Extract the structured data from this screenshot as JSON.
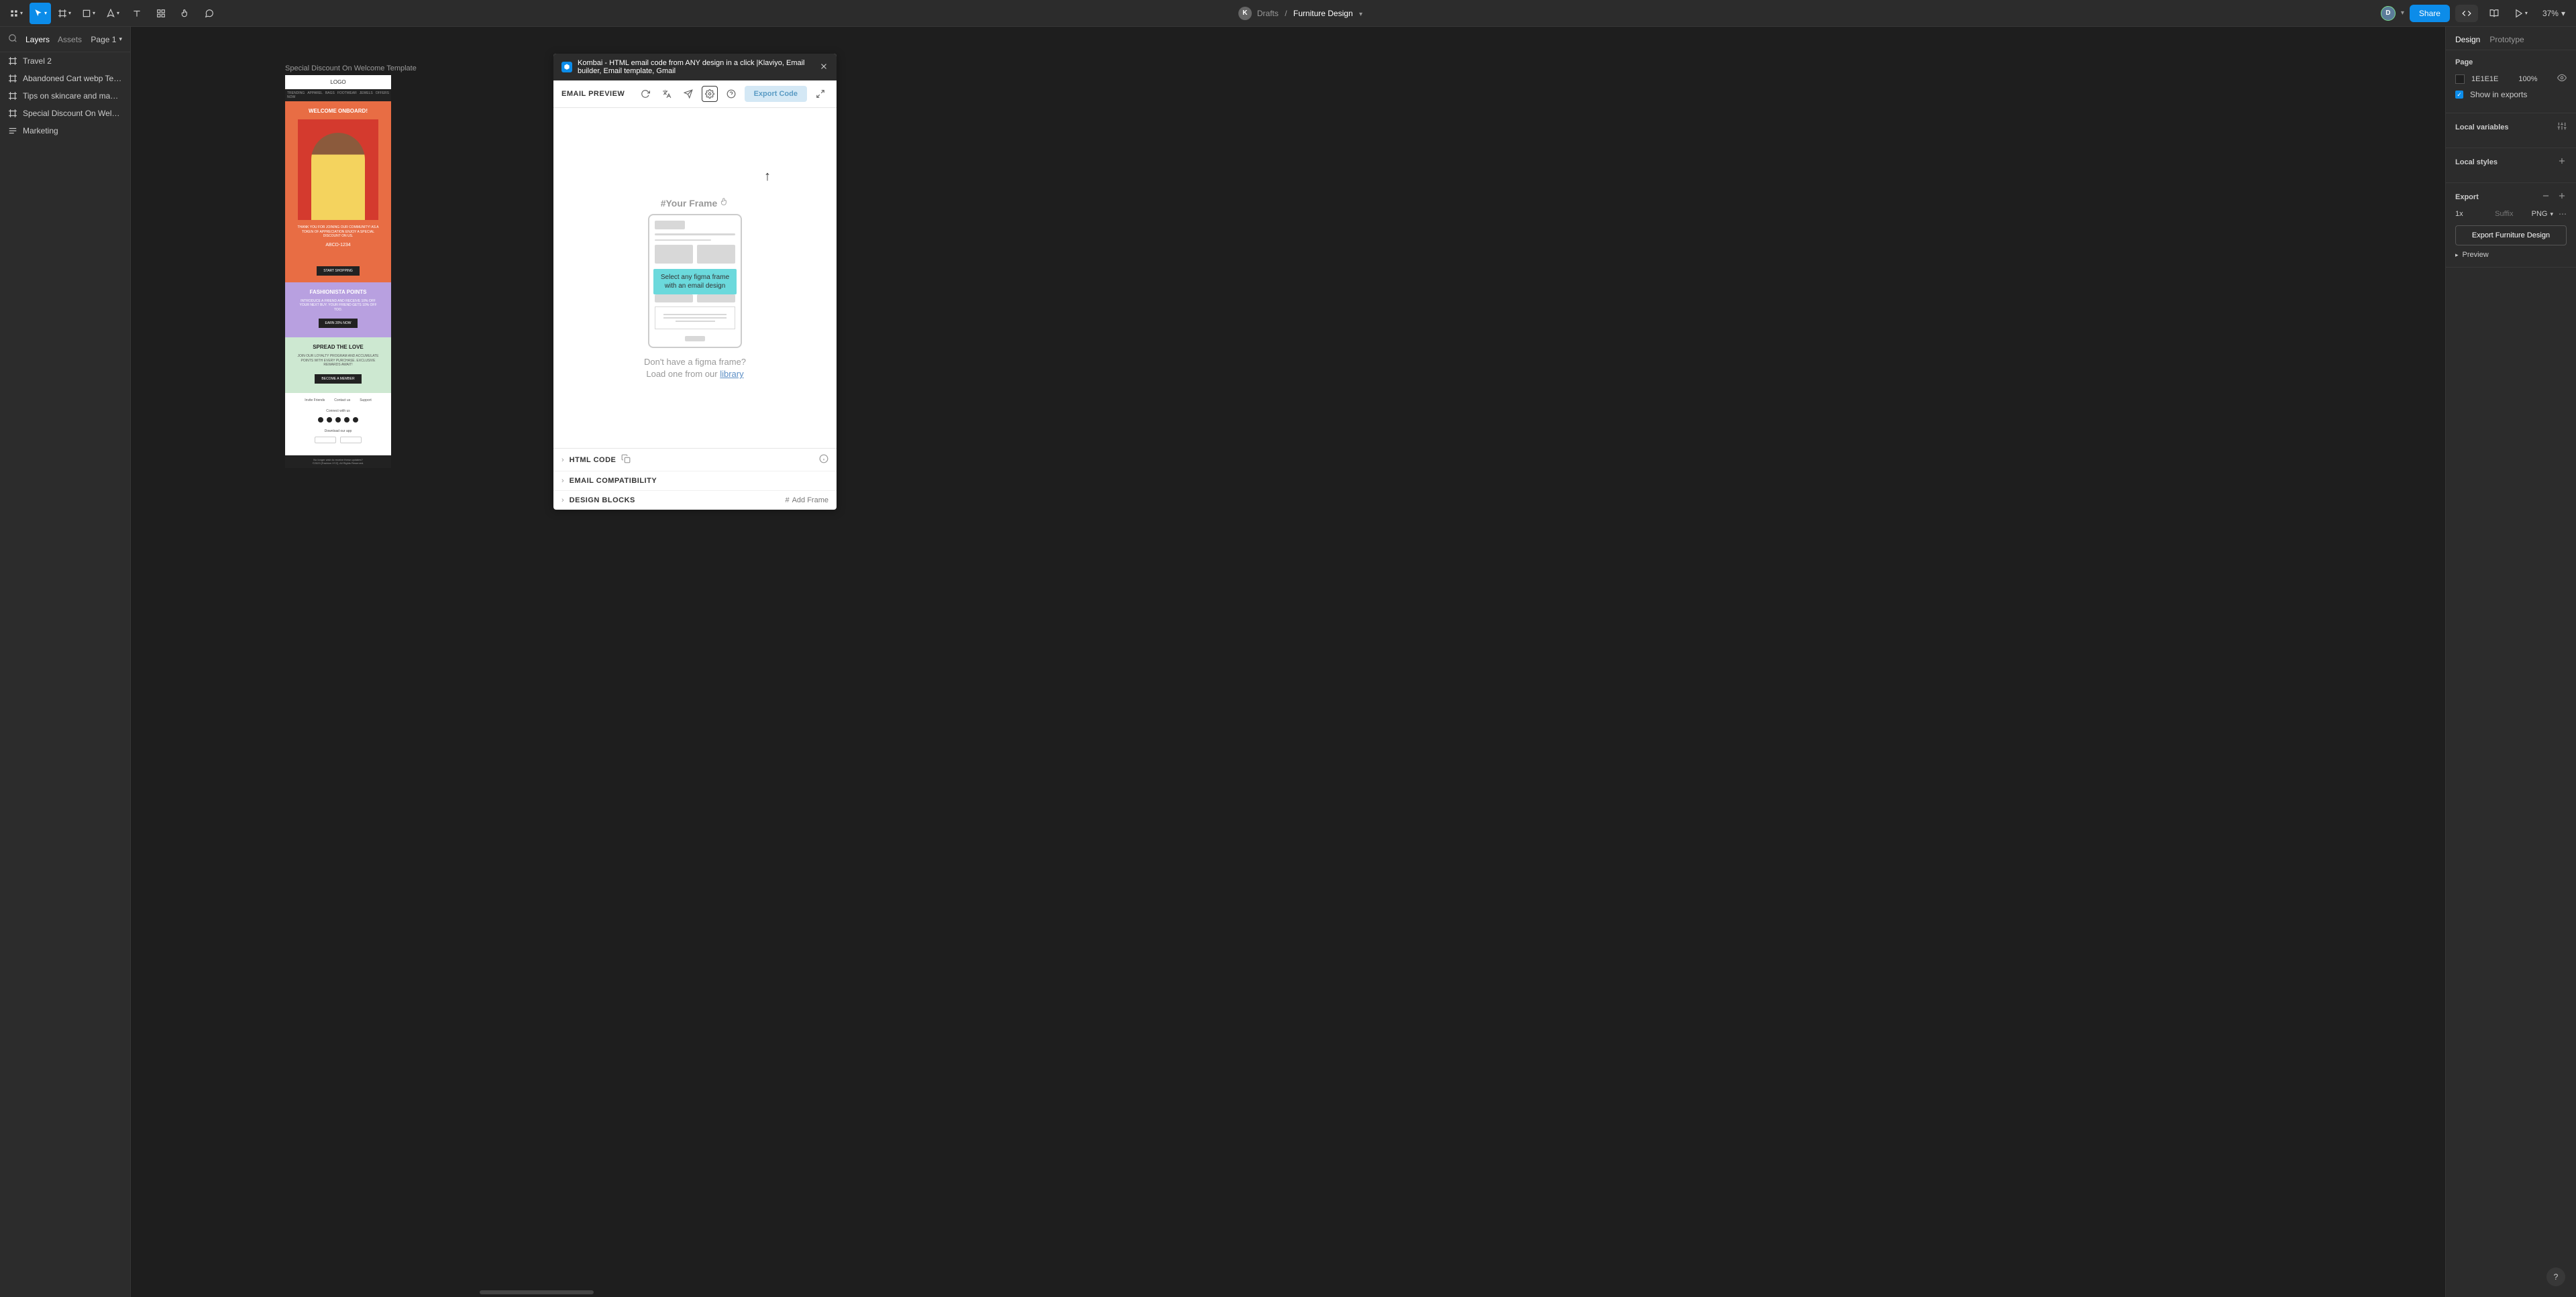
{
  "toolbar": {
    "avatar_k": "K",
    "avatar_d": "D",
    "breadcrumb_parent": "Drafts",
    "breadcrumb_current": "Furniture Design",
    "share_label": "Share",
    "zoom": "37%"
  },
  "left_panel": {
    "tab_layers": "Layers",
    "tab_assets": "Assets",
    "page_selector": "Page 1",
    "layers": [
      {
        "name": "Travel 2",
        "type": "frame"
      },
      {
        "name": "Abandoned Cart webp Template 5",
        "type": "frame"
      },
      {
        "name": "Tips on skincare and makeup 5",
        "type": "frame"
      },
      {
        "name": "Special Discount On Welcome Te...",
        "type": "frame"
      },
      {
        "name": "Marketing",
        "type": "text"
      }
    ]
  },
  "canvas": {
    "frame_label": "Special Discount On Welcome Template",
    "email": {
      "logo": "LOGO",
      "nav": [
        "TRENDING NOW",
        "APPAREL",
        "BAGS",
        "FOOTWEAR",
        "JEWELS",
        "OFFERS"
      ],
      "hero_title": "WELCOME ONBOARD!",
      "hero_text": "THANK YOU FOR JOINING OUR COMMUNITY! AS A TOKEN OF APPRECIATION ENJOY A SPECIAL DISCOUNT ON US.",
      "code": "ABCD-1234",
      "shop_btn": "START SHOPPING",
      "points_title": "FASHIONISTA POINTS",
      "points_text": "INTRODUCE A FRIEND AND RECEIVE 10% OFF YOUR NEXT BUY. YOUR FRIEND GETS 10% OFF TOO.",
      "points_btn": "EARN 20% NOW",
      "love_title": "SPREAD THE LOVE",
      "love_text": "JOIN OUR LOYALTY PROGRAM AND ACCUMULATE POINTS WITH EVERY PURCHASE. EXCLUSIVE REWARDS AWAIT!",
      "love_btn": "BECOME A MEMBER",
      "footer_links": [
        "Invite Friends",
        "Contact us",
        "Support"
      ],
      "connect": "Connect with us",
      "download": "Download our app",
      "copyright_1": "No longer wish to receive these updates?",
      "copyright_2": "©2023 [Fashion XYZ]. All Rights Reserved."
    }
  },
  "plugin": {
    "title": "Kombai - HTML email code from ANY design in a click |Klaviyo, Email builder, Email template, Gmail",
    "subtitle": "EMAIL PREVIEW",
    "export_code": "Export Code",
    "your_frame": "#Your Frame",
    "callout": "Select any figma frame with an email design",
    "hint_1": "Don't have a figma frame?",
    "hint_2": "Load one from our ",
    "hint_link": "library",
    "footer": {
      "html_code": "HTML CODE",
      "compat": "EMAIL COMPATIBILITY",
      "blocks": "DESIGN BLOCKS",
      "add_frame": "Add Frame"
    }
  },
  "right_panel": {
    "tab_design": "Design",
    "tab_prototype": "Prototype",
    "page_section": "Page",
    "page_color": "1E1E1E",
    "page_opacity": "100%",
    "show_exports": "Show in exports",
    "local_vars": "Local variables",
    "local_styles": "Local styles",
    "export_section": "Export",
    "export_scale": "1x",
    "export_suffix_placeholder": "Suffix",
    "export_format": "PNG",
    "export_button": "Export Furniture Design",
    "preview": "Preview"
  },
  "help": "?"
}
